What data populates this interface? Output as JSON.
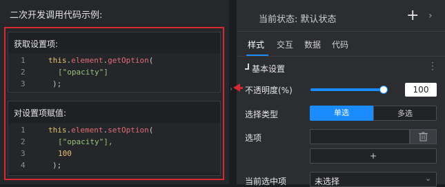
{
  "tooltip": {
    "title": "二次开发调用代码示例:",
    "get_card": {
      "heading": "获取设置项:",
      "lines": [
        {
          "n": "1",
          "kw": "this",
          "dot1": ".",
          "obj": "element",
          "dot2": ".",
          "method": "getOption",
          "rest": "("
        },
        {
          "n": "2",
          "str": "[\"opacity\"]"
        },
        {
          "n": "3",
          "close": ");"
        }
      ]
    },
    "set_card": {
      "heading": "对设置项赋值:",
      "lines": [
        {
          "n": "1",
          "kw": "this",
          "dot1": ".",
          "obj": "element",
          "dot2": ".",
          "method": "setOption",
          "rest": "("
        },
        {
          "n": "2",
          "str": "[\"opacity\"],"
        },
        {
          "n": "3",
          "num": "100"
        },
        {
          "n": "4",
          "close": ");"
        }
      ]
    }
  },
  "panel": {
    "state_label": "当前状态: 默认状态",
    "plus_symbol": "+",
    "chevron": "›",
    "tabs": [
      "样式",
      "交互",
      "数据",
      "代码"
    ],
    "section_title": "基本设置",
    "opacity": {
      "label": "不透明度(%)",
      "value": "100",
      "level": 1.0
    },
    "select_type": {
      "label": "选择类型",
      "options": [
        "单选",
        "多选"
      ],
      "selected": "单选"
    },
    "options_label": "选项",
    "add_label": "+",
    "current_label": "当前选中项",
    "current_value": "未选择"
  },
  "colors": {
    "accent": "#1a8cff",
    "highlight": "#d52a34"
  }
}
